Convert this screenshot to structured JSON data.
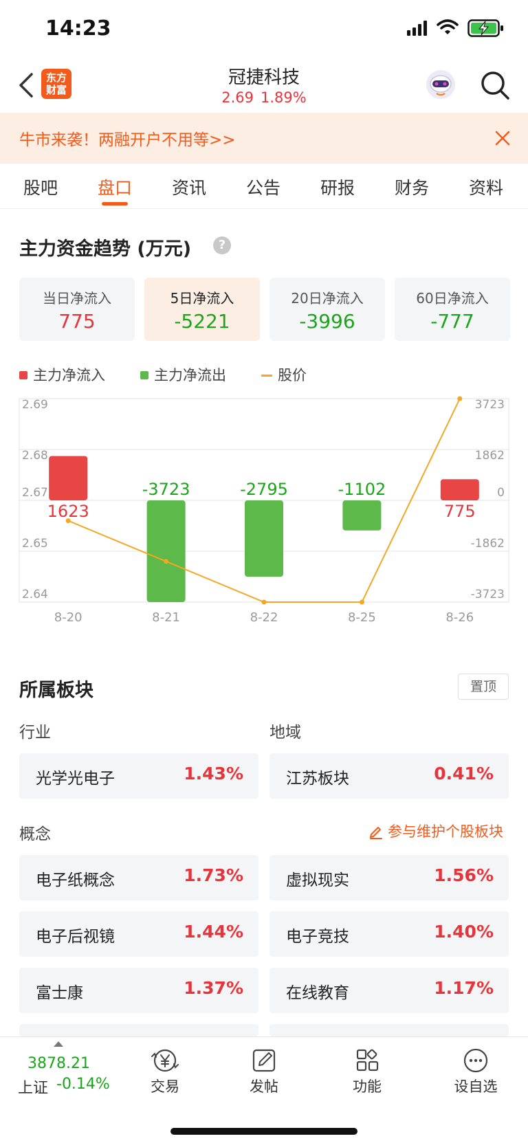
{
  "status_bar": {
    "time": "14:23"
  },
  "header": {
    "logo_text": "东方财富",
    "stock_name": "冠捷科技",
    "price": "2.69",
    "change_pct": "1.89%"
  },
  "banner": {
    "text": "牛市来袭！两融开户不用等>>"
  },
  "tabs": [
    {
      "label": "股吧"
    },
    {
      "label": "盘口",
      "active": true
    },
    {
      "label": "资讯"
    },
    {
      "label": "公告"
    },
    {
      "label": "研报"
    },
    {
      "label": "财务"
    },
    {
      "label": "资料"
    }
  ],
  "capital_flow": {
    "title": "主力资金趋势 (万元)",
    "help_glyph": "?",
    "cards": [
      {
        "label": "当日净流入",
        "value": "775",
        "color": "#e5353b"
      },
      {
        "label": "5日净流入",
        "value": "-5221",
        "color": "#1aa51a",
        "selected": true
      },
      {
        "label": "20日净流入",
        "value": "-3996",
        "color": "#1aa51a"
      },
      {
        "label": "60日净流入",
        "value": "-777",
        "color": "#1aa51a"
      }
    ],
    "legend": [
      {
        "label": "主力净流入",
        "color": "#e84545",
        "kind": "box"
      },
      {
        "label": "主力净流出",
        "color": "#5cb94a",
        "kind": "box"
      },
      {
        "label": "股价",
        "color": "#f5a623",
        "kind": "line"
      }
    ]
  },
  "chart_data": {
    "type": "bar",
    "categories": [
      "8-20",
      "8-21",
      "8-22",
      "8-25",
      "8-26"
    ],
    "series": [
      {
        "name": "主力净流入",
        "values": [
          1623,
          -3723,
          -2795,
          -1102,
          775
        ]
      },
      {
        "name": "股价",
        "type": "line",
        "values": [
          2.66,
          2.65,
          2.64,
          2.64,
          2.69
        ]
      }
    ],
    "bar_labels": [
      "1623",
      "-3723",
      "-2795",
      "-1102",
      "775"
    ],
    "left_axis": {
      "ticks": [
        "2.69",
        "2.68",
        "2.67",
        "2.65",
        "2.64"
      ],
      "range": [
        2.64,
        2.69
      ]
    },
    "right_axis": {
      "ticks": [
        "3723",
        "1862",
        "0",
        "-1862",
        "-3723"
      ],
      "range": [
        -3723,
        3723
      ]
    },
    "colors": {
      "inflow": "#e84545",
      "outflow": "#5cb94a",
      "price": "#f5a623"
    },
    "grid": true
  },
  "sectors": {
    "title": "所属板块",
    "pin_label": "置顶",
    "industry_label": "行业",
    "region_label": "地域",
    "industry": {
      "name": "光学光电子",
      "pct": "1.43%"
    },
    "region": {
      "name": "江苏板块",
      "pct": "0.41%"
    },
    "concept_label": "概念",
    "maintain_label": "参与维护个股板块",
    "concepts": [
      {
        "name": "电子纸概念",
        "pct": "1.73%"
      },
      {
        "name": "虚拟现实",
        "pct": "1.56%"
      },
      {
        "name": "电子后视镜",
        "pct": "1.44%"
      },
      {
        "name": "电子竞技",
        "pct": "1.40%"
      },
      {
        "name": "富士康",
        "pct": "1.37%"
      },
      {
        "name": "在线教育",
        "pct": "1.17%"
      }
    ]
  },
  "bottom_bar": {
    "index_value": "3878.21",
    "index_name": "上证",
    "index_change": "-0.14%",
    "items": [
      {
        "label": "交易",
        "icon": "trade-yen-icon"
      },
      {
        "label": "发帖",
        "icon": "edit-post-icon"
      },
      {
        "label": "功能",
        "icon": "grid-apps-icon"
      },
      {
        "label": "设自选",
        "icon": "more-dots-icon"
      }
    ]
  }
}
